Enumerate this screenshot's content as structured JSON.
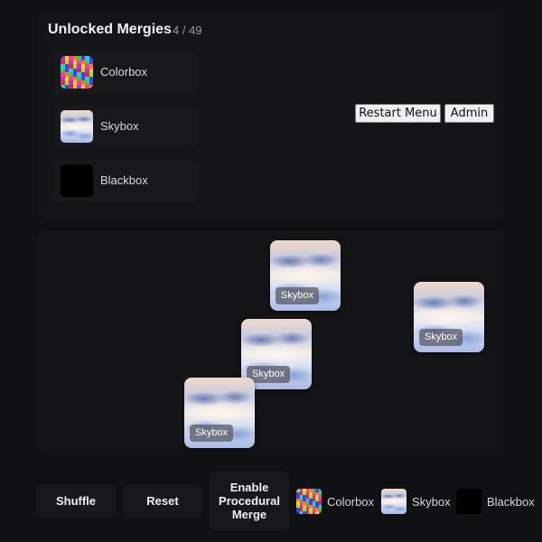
{
  "unlocked_panel": {
    "title": "Unlocked Mergies",
    "count": "4 / 49",
    "items": [
      {
        "label": "Colorbox",
        "icon": "colorbox-thumbnail"
      },
      {
        "label": "Skybox",
        "icon": "skybox-thumbnail"
      },
      {
        "label": "Blackbox",
        "icon": "blackbox-thumbnail"
      }
    ]
  },
  "system_buttons": {
    "restart_menu": "Restart Menu",
    "admin": "Admin"
  },
  "board": {
    "tiles": [
      {
        "label": "Skybox"
      },
      {
        "label": "Skybox"
      },
      {
        "label": "Skybox"
      },
      {
        "label": "Skybox"
      }
    ]
  },
  "toolbar": {
    "shuffle": "Shuffle",
    "reset": "Reset",
    "enable_procedural_merge": "Enable Procedural Merge",
    "legend": [
      {
        "label": "Colorbox"
      },
      {
        "label": "Skybox"
      },
      {
        "label": "Blackbox"
      }
    ]
  },
  "colors": {
    "background": "#101113",
    "panel": "#141517",
    "button": "#17181a",
    "tag": "#5a5a64"
  }
}
